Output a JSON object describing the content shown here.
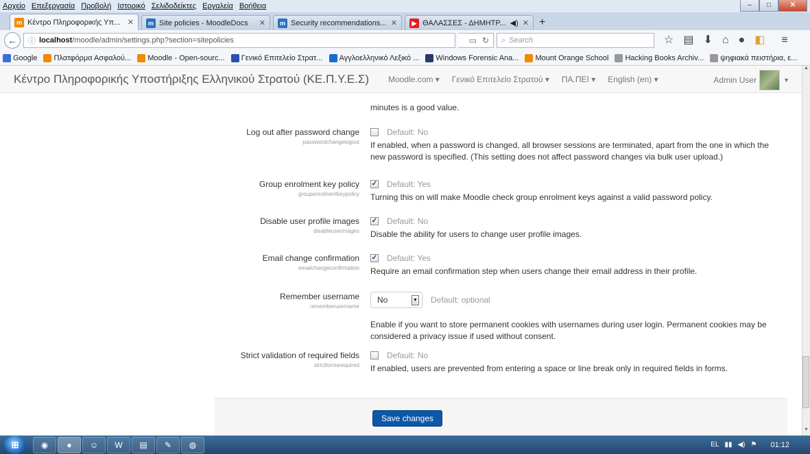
{
  "menubar": [
    "Αρχείο",
    "Επεξεργασία",
    "Προβολή",
    "Ιστορικό",
    "Σελιδοδείκτες",
    "Εργαλεία",
    "Βοήθεια"
  ],
  "tabs": [
    {
      "title": "Κέντρο Πληροφορικής Υπ...",
      "icon": "moodle-favicon",
      "active": true,
      "extra": ""
    },
    {
      "title": "Site policies - MoodleDocs",
      "icon": "moodledocs-favicon",
      "active": false,
      "extra": ""
    },
    {
      "title": "Security recommendations...",
      "icon": "moodledocs-favicon",
      "active": false,
      "extra": ""
    },
    {
      "title": "ΘΑΛΑΣΣΕΣ - ΔΗΜΗΤΡ...",
      "icon": "youtube-favicon",
      "active": false,
      "extra": "◀)"
    }
  ],
  "url": {
    "host": "localhost",
    "path": "/moodle/admin/settings.php?section=sitepolicies"
  },
  "search_placeholder": "Search",
  "bookmarks": [
    {
      "label": "Google",
      "icon": "google-icon",
      "color": "#3b6fd8"
    },
    {
      "label": "Πλατφόρμα Ασφαλού...",
      "icon": "moodle-icon",
      "color": "#f08a00"
    },
    {
      "label": "Moodle - Open-sourc...",
      "icon": "moodle-icon",
      "color": "#f08a00"
    },
    {
      "label": "Γενικό Επιτελείο Στρατ...",
      "icon": "army-icon",
      "color": "#2a4fb0"
    },
    {
      "label": "Αγγλοελληνικό Λεξικό ...",
      "icon": "wordreference-icon",
      "color": "#1b6bcf"
    },
    {
      "label": "Windows Forensic Ana...",
      "icon": "book-icon",
      "color": "#283a66"
    },
    {
      "label": "Mount Orange School",
      "icon": "moodle-icon",
      "color": "#f08a00"
    },
    {
      "label": "Hacking Books Archiv...",
      "icon": "globe-icon",
      "color": "#999999"
    },
    {
      "label": "ψηφιακά πειστήρια, ε...",
      "icon": "globe-icon",
      "color": "#999999"
    }
  ],
  "site": {
    "brand": "Κέντρο Πληροφορικής Υποστήριξης Ελληνικού Στρατού (ΚΕ.Π.Υ.Ε.Σ)",
    "nav": [
      "Moodle.com ▾",
      "Γενικό Επιτελείο Στρατού ▾",
      "ΠΑ.ΠΕΙ ▾",
      "English (en) ▾"
    ],
    "user": "Admin User"
  },
  "cutoff_text": "minutes is a good value.",
  "settings": [
    {
      "label": "Log out after password change",
      "name": "passwordchangelogout",
      "type": "checkbox",
      "checked": false,
      "default": "Default: No",
      "desc": "If enabled, when a password is changed, all browser sessions are terminated, apart from the one in which the new password is specified. (This setting does not affect password changes via bulk user upload.)"
    },
    {
      "label": "Group enrolment key policy",
      "name": "groupenrolmentkeypolicy",
      "type": "checkbox",
      "checked": true,
      "default": "Default: Yes",
      "desc": "Turning this on will make Moodle check group enrolment keys against a valid password policy."
    },
    {
      "label": "Disable user profile images",
      "name": "disableuserimages",
      "type": "checkbox",
      "checked": true,
      "default": "Default: No",
      "desc": "Disable the ability for users to change user profile images."
    },
    {
      "label": "Email change confirmation",
      "name": "emailchangeconfirmation",
      "type": "checkbox",
      "checked": true,
      "default": "Default: Yes",
      "desc": "Require an email confirmation step when users change their email address in their profile."
    },
    {
      "label": "Remember username",
      "name": "rememberusername",
      "type": "select",
      "value": "No",
      "default": "Default: optional",
      "desc": "Enable if you want to store permanent cookies with usernames during user login. Permanent cookies may be considered a privacy issue if used without consent."
    },
    {
      "label": "Strict validation of required fields",
      "name": "strictformsrequired",
      "type": "checkbox",
      "checked": false,
      "default": "Default: No",
      "desc": "If enabled, users are prevented from entering a space or line break only in required fields in forms."
    }
  ],
  "save_label": "Save changes",
  "taskbar": {
    "lang": "EL",
    "clock": "01:12"
  }
}
